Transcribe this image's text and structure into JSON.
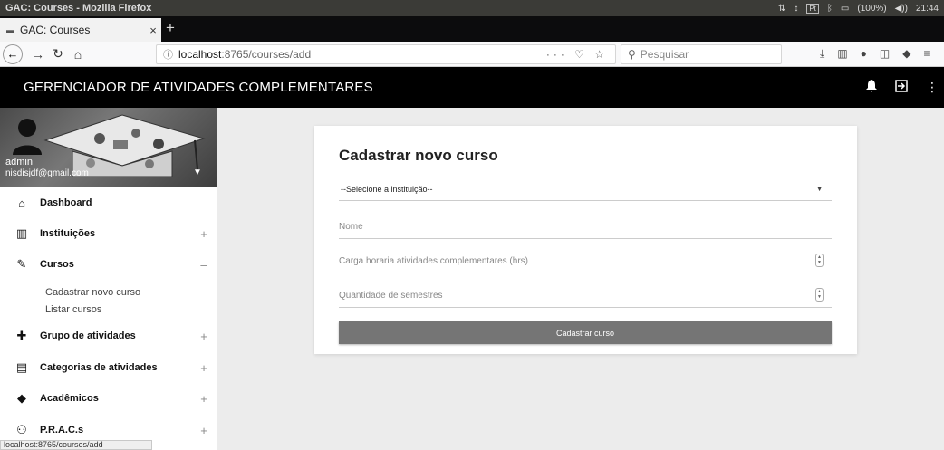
{
  "os": {
    "window_title": "GAC: Courses - Mozilla Firefox",
    "lang_badge": "Pt",
    "battery": "(100%)",
    "clock": "21:44"
  },
  "browser": {
    "tab_title": "GAC: Courses",
    "tab_close": "×",
    "new_tab": "+",
    "url_host": "localhost",
    "url_path": ":8765/courses/add",
    "url_actions": "··· ♡ ☆",
    "search_placeholder": "Pesquisar",
    "status_url": "localhost:8765/courses/add"
  },
  "app": {
    "title": "GERENCIADOR DE ATIVIDADES COMPLEMENTARES"
  },
  "profile": {
    "name": "admin",
    "email": "nisdisjdf@gmail.com"
  },
  "sidebar": {
    "items": [
      {
        "label": "Dashboard",
        "icon": "home-icon",
        "toggle": ""
      },
      {
        "label": "Instituições",
        "icon": "building-icon",
        "toggle": "+"
      },
      {
        "label": "Cursos",
        "icon": "pencil-icon",
        "toggle": "–"
      },
      {
        "label": "Grupo de atividades",
        "icon": "puzzle-icon",
        "toggle": "+"
      },
      {
        "label": "Categorias de atividades",
        "icon": "document-icon",
        "toggle": "+"
      },
      {
        "label": "Acadêmicos",
        "icon": "graduation-cap-icon",
        "toggle": "+"
      },
      {
        "label": "P.R.A.C.s",
        "icon": "people-icon",
        "toggle": "+"
      }
    ],
    "submenu": [
      {
        "label": "Cadastrar novo curso"
      },
      {
        "label": "Listar cursos"
      }
    ]
  },
  "form": {
    "title": "Cadastrar novo curso",
    "institution_select": "--Selecione a instituição--",
    "name_placeholder": "Nome",
    "hours_placeholder": "Carga horaria atividades complementares (hrs)",
    "semesters_placeholder": "Quantidade de semestres",
    "submit_label": "Cadastrar curso"
  },
  "colors": {
    "header_bg": "#000000",
    "button_bg": "#757575",
    "page_bg": "#ececec"
  }
}
